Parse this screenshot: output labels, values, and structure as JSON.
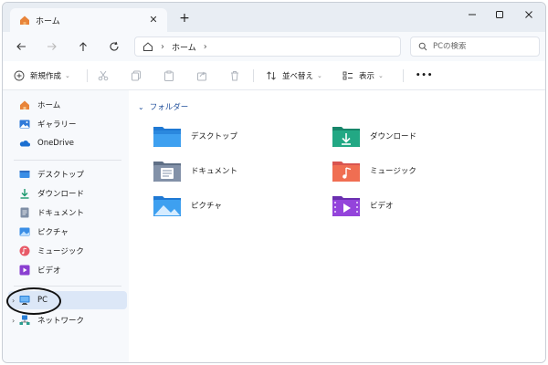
{
  "tab": {
    "title": "ホーム"
  },
  "search": {
    "placeholder": "PCの検索"
  },
  "address": {
    "crumbs": [
      "ホーム"
    ]
  },
  "toolbar": {
    "new_label": "新規作成",
    "sort_label": "並べ替え",
    "view_label": "表示",
    "more_label": "•••"
  },
  "sidebar": {
    "items": [
      {
        "label": "ホーム",
        "icon": "home-icon"
      },
      {
        "label": "ギャラリー",
        "icon": "gallery-icon"
      },
      {
        "label": "OneDrive",
        "icon": "onedrive-icon"
      },
      {
        "label": "デスクトップ",
        "icon": "desktop-icon"
      },
      {
        "label": "ダウンロード",
        "icon": "download-icon"
      },
      {
        "label": "ドキュメント",
        "icon": "documents-icon"
      },
      {
        "label": "ピクチャ",
        "icon": "pictures-icon"
      },
      {
        "label": "ミュージック",
        "icon": "music-icon"
      },
      {
        "label": "ビデオ",
        "icon": "video-icon"
      },
      {
        "label": "PC",
        "icon": "pc-icon",
        "selected": true
      },
      {
        "label": "ネットワーク",
        "icon": "network-icon"
      }
    ]
  },
  "content": {
    "group_header": "フォルダー",
    "folders": [
      {
        "label": "デスクトップ",
        "icon": "desktop-folder-icon"
      },
      {
        "label": "ダウンロード",
        "icon": "download-folder-icon"
      },
      {
        "label": "ドキュメント",
        "icon": "documents-folder-icon"
      },
      {
        "label": "ミュージック",
        "icon": "music-folder-icon"
      },
      {
        "label": "ピクチャ",
        "icon": "pictures-folder-icon"
      },
      {
        "label": "ビデオ",
        "icon": "video-folder-icon"
      }
    ]
  },
  "colors": {
    "accent": "#1f4e9b",
    "selection": "#dce7f7",
    "sidebar_bg": "#f7f9fc",
    "titlebar_bg": "#e8edf3"
  }
}
